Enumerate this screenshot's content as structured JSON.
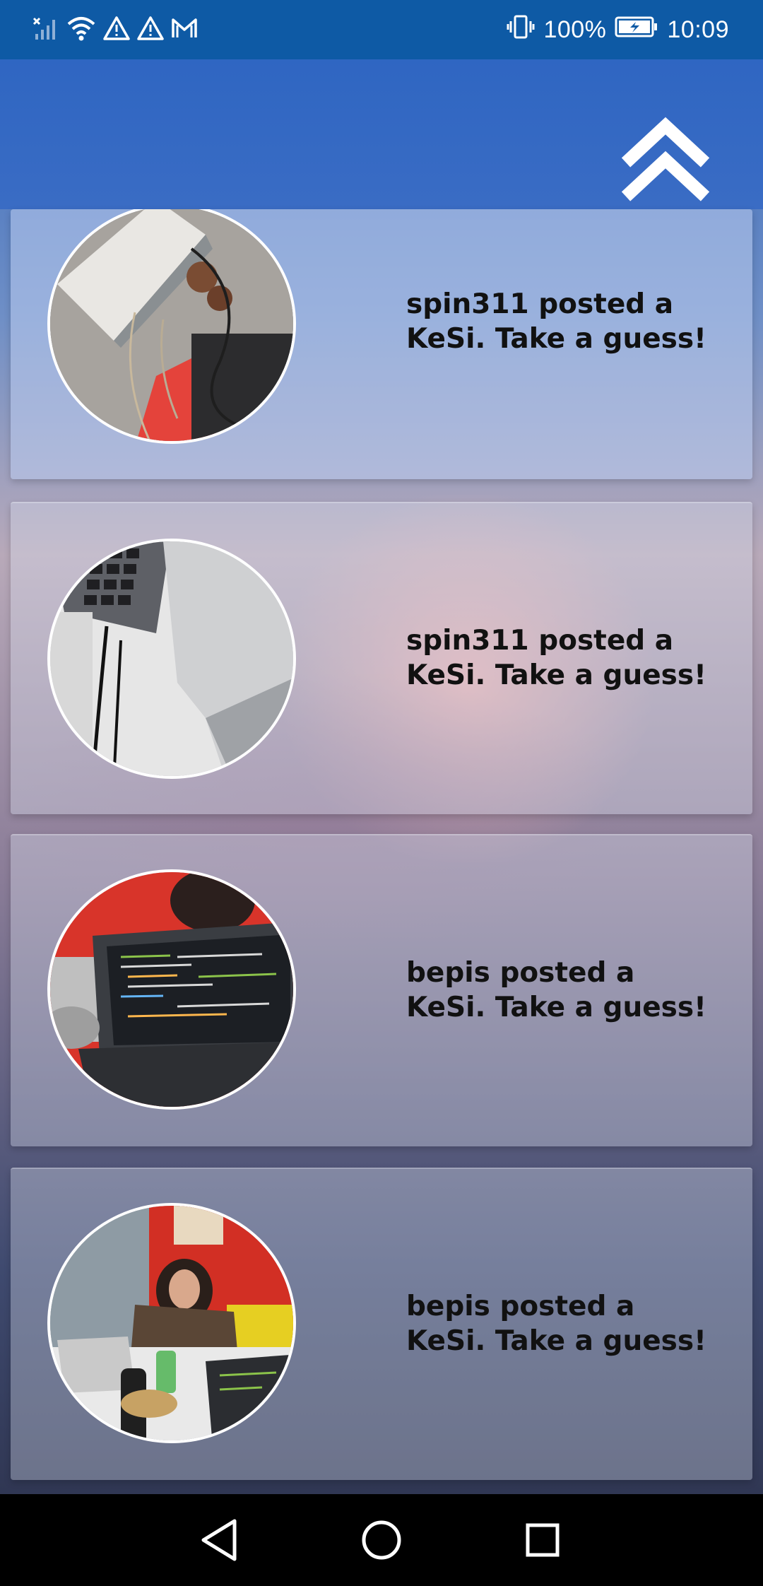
{
  "status_bar": {
    "battery_percent": "100%",
    "time": "10:09",
    "icons": [
      "no-sim-signal-icon",
      "wifi-icon",
      "warning-icon",
      "warning-icon",
      "gmail-icon",
      "vibrate-icon",
      "battery-charging-icon"
    ]
  },
  "header": {
    "scroll_top_icon": "double-chevron-up-icon"
  },
  "feed": {
    "posts": [
      {
        "text": "spin311 posted a KeSi. Take a guess!",
        "image": "photo-desk-cables"
      },
      {
        "text": "spin311 posted a KeSi. Take a guess!",
        "image": "photo-laptop-cable"
      },
      {
        "text": "bepis posted a KeSi. Take a guess!",
        "image": "photo-laptop-code"
      },
      {
        "text": "bepis posted a KeSi. Take a guess!",
        "image": "photo-office-person"
      }
    ]
  },
  "nav_bar": {
    "icons": [
      "back-icon",
      "home-icon",
      "recents-icon"
    ]
  }
}
